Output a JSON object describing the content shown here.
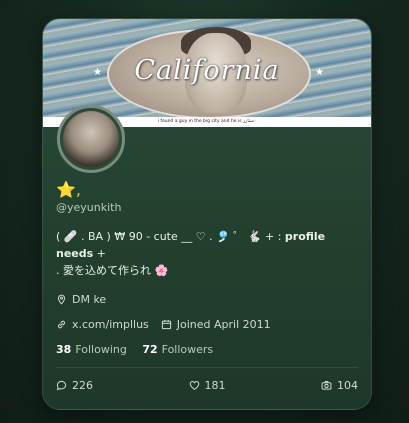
{
  "banner": {
    "script_text": "California",
    "caption": "i found a guy in the big city and he is ٠ستارز",
    "stars": [
      "★",
      "★"
    ]
  },
  "profile": {
    "display_name": "⭐,",
    "handle": "@yeyunkith",
    "bio_line1_plain": "( 🩹 . BA ) ₩ 90 - cute __ ♡ . 🎐 ゜ 🐇 + : ",
    "bio_line1_bold": "profile needs",
    "bio_line1_end": " +",
    "bio_line2": ". 愛を込めて作られ 🌸",
    "location": "DM ke",
    "link": "x.com/impllus",
    "joined": "Joined April 2011",
    "following_count": "38",
    "following_label": "Following",
    "followers_count": "72",
    "followers_label": "Followers"
  },
  "stats": {
    "replies": "226",
    "likes": "181",
    "media": "104"
  },
  "icons": {
    "location": "map-pin-icon",
    "link": "link-icon",
    "calendar": "calendar-icon",
    "comment": "comment-icon",
    "heart": "heart-icon",
    "camera": "camera-icon"
  },
  "colors": {
    "background": "#162a20",
    "card": "#23402f",
    "accent_star": "#f6c624",
    "text": "#e8efe9",
    "muted": "#b9c8bd"
  }
}
